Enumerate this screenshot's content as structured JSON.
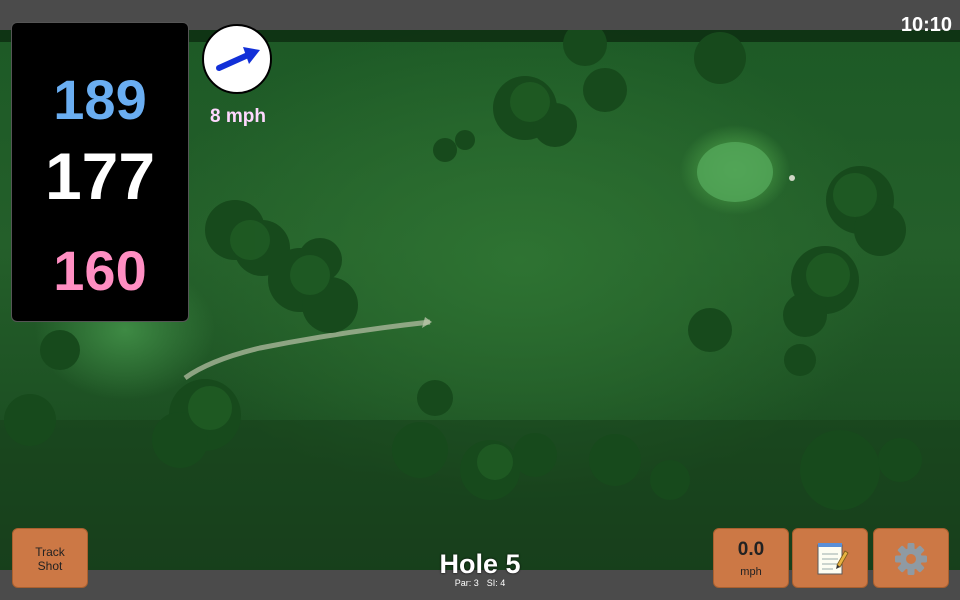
{
  "status": {
    "time": "10:10"
  },
  "yardage": {
    "back": "189",
    "middle": "177",
    "front": "160"
  },
  "wind": {
    "speed_label": "8 mph",
    "direction_icon": "arrow-east-northeast-icon",
    "arrow_color": "#1230d8"
  },
  "hole": {
    "title": "Hole 5",
    "par": "Par: 3",
    "stroke_index": "SI: 4"
  },
  "buttons": {
    "track_shot_line1": "Track",
    "track_shot_line2": "Shot",
    "wind_value": "0.0",
    "wind_unit": "mph",
    "notes_icon": "notepad-icon",
    "settings_icon": "gear-icon"
  },
  "colors": {
    "back_yardage": "#6aaef2",
    "middle_yardage": "#ffffff",
    "front_yardage": "#ff8ec2",
    "button_fill": "#cc7845",
    "wind_label": "#ffd8ff"
  }
}
